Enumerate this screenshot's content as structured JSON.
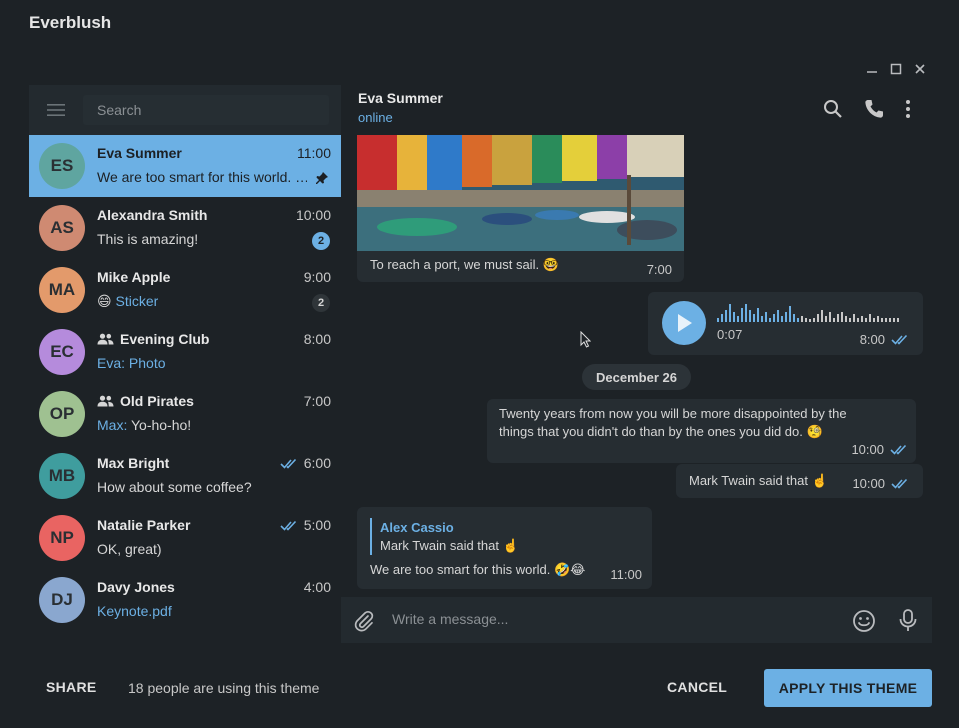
{
  "app": {
    "title": "Everblush"
  },
  "colors": {
    "accent": "#6cb0e4",
    "background": "#1d2226",
    "panel": "#232a2f",
    "bubble": "#262d32"
  },
  "left": {
    "search_placeholder": "Search",
    "chats": [
      {
        "initials": "ES",
        "name": "Eva Summer",
        "time": "11:00",
        "preview": "We are too smart for this world. …",
        "avatar_color": "#5fa5a0",
        "pinned": true
      },
      {
        "initials": "AS",
        "name": "Alexandra Smith",
        "time": "10:00",
        "preview": "This is amazing!",
        "avatar_color": "#cf8a72",
        "badge": "2"
      },
      {
        "initials": "MA",
        "name": "Mike Apple",
        "time": "9:00",
        "preview_emoji": "😄",
        "preview": "Sticker",
        "avatar_color": "#e39a6b",
        "badge": "2"
      },
      {
        "initials": "EC",
        "name": "Evening Club",
        "time": "8:00",
        "preview_sender": "Eva:",
        "preview": "Photo",
        "avatar_color": "#b58bdc"
      },
      {
        "initials": "OP",
        "name": "Old Pirates",
        "time": "7:00",
        "preview_sender": "Max:",
        "preview": "Yo-ho-ho!",
        "avatar_color": "#9fc191"
      },
      {
        "initials": "MB",
        "name": "Max Bright",
        "time": "6:00",
        "preview": "How about some coffee?",
        "avatar_color": "#3f9d9e"
      },
      {
        "initials": "NP",
        "name": "Natalie Parker",
        "time": "5:00",
        "preview": "OK, great)",
        "avatar_color": "#e96462"
      },
      {
        "initials": "DJ",
        "name": "Davy Jones",
        "time": "4:00",
        "preview": "Keynote.pdf",
        "avatar_color": "#8aa7cf"
      }
    ]
  },
  "right": {
    "peer_name": "Eva Summer",
    "peer_status": "online",
    "photo_caption": "To reach a port, we must sail. 🤓",
    "photo_time": "7:00",
    "voice_duration": "0:07",
    "voice_time": "8:00",
    "date_separator": "December 26",
    "msg1": "Twenty years from now you will be more disappointed by the things that you didn't do than by the ones you did do. 🧐",
    "msg1_time": "10:00",
    "msg2": "Mark Twain said that ☝️",
    "msg2_time": "10:00",
    "reply_author": "Alex Cassio",
    "reply_quote": "Mark Twain said that ☝️",
    "reply_text": "We are too smart for this world. 🤣😂",
    "reply_time": "11:00",
    "composer_placeholder": "Write a message..."
  },
  "footer": {
    "share_label": "SHARE",
    "usage_text": "18 people are using this theme",
    "cancel_label": "CANCEL",
    "apply_label": "APPLY THIS THEME"
  }
}
